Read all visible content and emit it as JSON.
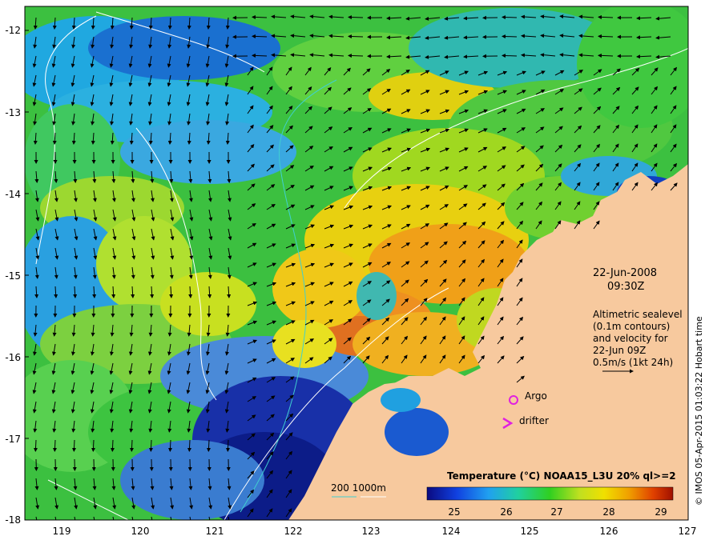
{
  "map": {
    "x_ticks": [
      "119",
      "120",
      "121",
      "122",
      "123",
      "124",
      "125",
      "126",
      "127"
    ],
    "y_ticks": [
      "-12",
      "-13",
      "-14",
      "-15",
      "-16",
      "-17",
      "-18"
    ],
    "date": "22-Jun-2008",
    "time": "09:30Z",
    "legend_lines": [
      "Altimetric sealevel",
      "(0.1m contours)",
      "and velocity for",
      "22-Jun 09Z",
      "0.5m/s (1kt 24h)"
    ],
    "argo_label": "Argo",
    "drifter_label": "drifter",
    "depth_label": "200  1000m",
    "colorbar_title": "Temperature (°C) NOAA15_L3U 20% ql>=2",
    "colorbar_ticks": [
      "25",
      "26",
      "27",
      "28",
      "29"
    ],
    "credit": "© IMOS 05-Apr-2015 01:03:22 Hobart time",
    "colors": {
      "land": "#f7c99e",
      "argo": "#e020e0",
      "drifter": "#e020e0",
      "contour": "#ffffff",
      "depth_200": "#40d0d0"
    }
  }
}
